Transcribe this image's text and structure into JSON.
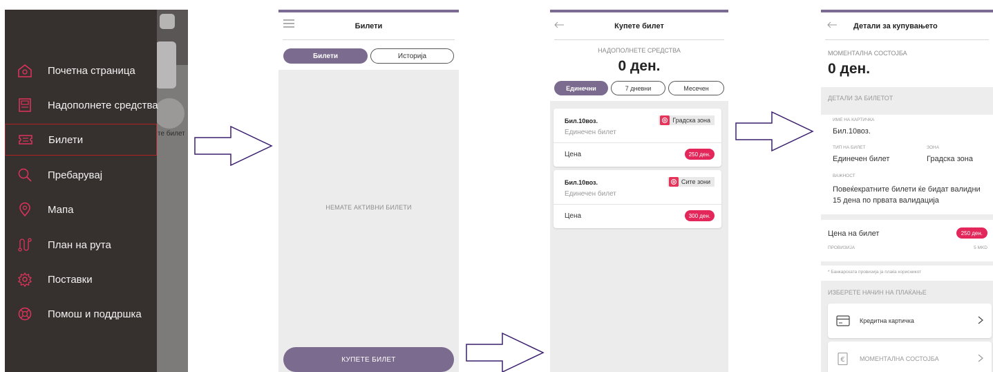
{
  "drawer": {
    "behind_text": "те билет",
    "items": [
      {
        "label": "Почетна страница",
        "icon": "home-icon"
      },
      {
        "label": "Надополнете средства",
        "icon": "wallet-icon"
      },
      {
        "label": "Билети",
        "icon": "ticket-icon"
      },
      {
        "label": "Пребарувај",
        "icon": "search-icon"
      },
      {
        "label": "Мапа",
        "icon": "map-pin-icon"
      },
      {
        "label": "План на рута",
        "icon": "route-icon"
      },
      {
        "label": "Поставки",
        "icon": "gear-icon"
      },
      {
        "label": "Помош и поддршка",
        "icon": "lifebuoy-icon"
      }
    ],
    "active_index": 2
  },
  "tickets_screen": {
    "title": "Билети",
    "tabs": [
      "Билети",
      "Историја"
    ],
    "active_tab": 0,
    "empty_text": "НЕМАТЕ АКТИВНИ БИЛЕТИ",
    "buy_button": "КУПЕТЕ БИЛЕТ"
  },
  "buy_screen": {
    "title": "Купете билет",
    "topup_label": "НАДОПОЛНЕТЕ СРЕДСТВА",
    "balance": "0 ден.",
    "tabs": [
      "Единечни",
      "7 дневни",
      "Месечен"
    ],
    "active_tab": 0,
    "price_label": "Цена",
    "cards": [
      {
        "name": "Бил.10воз.",
        "type": "Единечен билет",
        "zone": "Градска зона",
        "price": "250 ден."
      },
      {
        "name": "Бил.10воз.",
        "type": "Единечен билет",
        "zone": "Сите зони",
        "price": "300 ден."
      }
    ]
  },
  "details_screen": {
    "title": "Детали за купувањето",
    "balance_label": "МОМЕНТАЛНА СОСТОЈБА",
    "balance": "0 ден.",
    "ticket_section": "ДЕТАЛИ ЗА БИЛЕТОТ",
    "card_name_label": "ИМЕ НА КАРТИЧКА",
    "card_name": "Бил.10воз.",
    "ticket_type_label": "ТИП НА БИЛЕТ",
    "ticket_type": "Единечен билет",
    "zone_label": "ЗОНА",
    "zone": "Градска зона",
    "validity_label": "ВАЖНОСТ",
    "validity": "Повеќекратните билети ќе бидат валидни 15 дена по првата валидација",
    "price_label": "Цена на билет",
    "price": "250 ден.",
    "fee_label": "ПРОВИЗИЈА",
    "fee": "5 MKD",
    "fee_note": "* Банкарската провизија ја плаќа корисникот",
    "payment_section": "ИЗБЕРЕТЕ НАЧИН НА ПЛАЌАЊЕ",
    "payment_methods": [
      {
        "label": "Кредитна картичка",
        "icon": "credit-card-icon"
      },
      {
        "label": "МОМЕНТАЛНА СОСТОЈБА",
        "icon": "euro-wallet-icon"
      }
    ]
  },
  "colors": {
    "accent_purple": "#7b6b8e",
    "accent_red": "#e3275a",
    "drawer_bg": "#36302e",
    "arrow_stroke": "#3a1f6e"
  }
}
